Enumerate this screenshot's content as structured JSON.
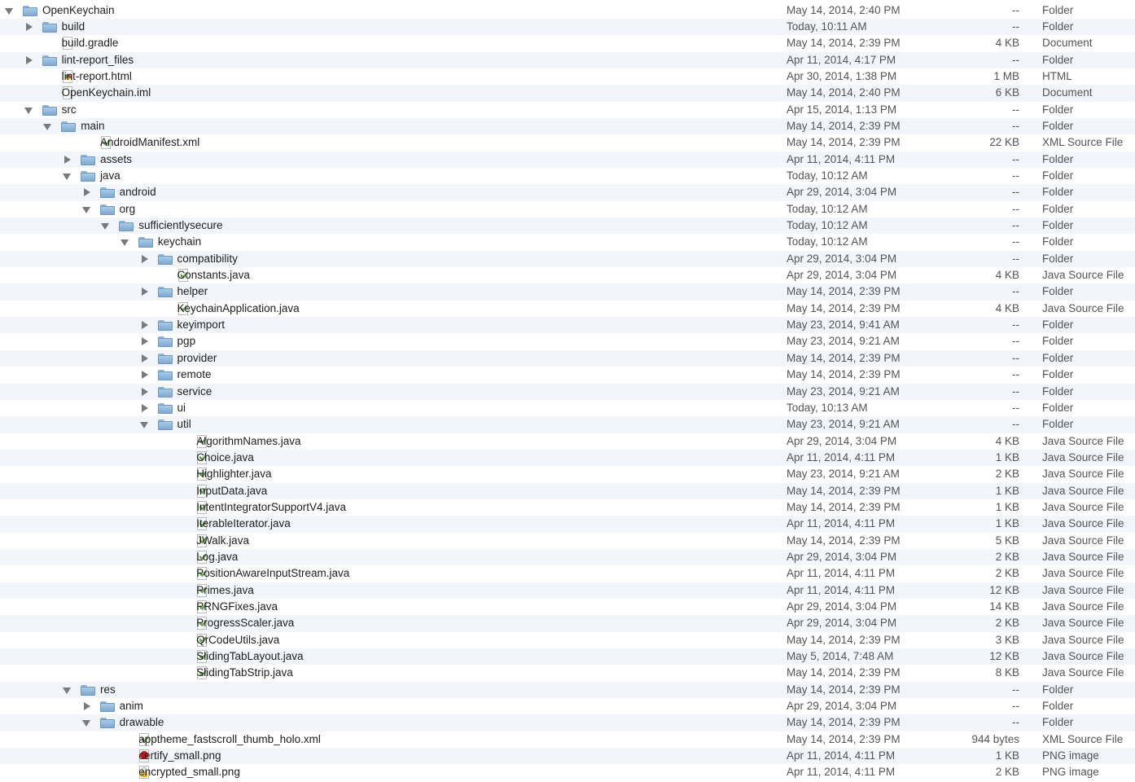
{
  "rows": [
    {
      "name": "OpenKeychain",
      "level": 0,
      "state": "open",
      "icon": "folder",
      "date": "May 14, 2014, 2:40 PM",
      "size": "--",
      "kind": "Folder"
    },
    {
      "name": "build",
      "level": 1,
      "state": "closed",
      "icon": "folder",
      "date": "Today, 10:11 AM",
      "size": "--",
      "kind": "Folder"
    },
    {
      "name": "build.gradle",
      "level": 1,
      "state": "",
      "icon": "document",
      "date": "May 14, 2014, 2:39 PM",
      "size": "4 KB",
      "kind": "Document"
    },
    {
      "name": "lint-report_files",
      "level": 1,
      "state": "closed",
      "icon": "folder",
      "date": "Apr 11, 2014, 4:17 PM",
      "size": "--",
      "kind": "Folder"
    },
    {
      "name": "lint-report.html",
      "level": 1,
      "state": "",
      "icon": "html",
      "date": "Apr 30, 2014, 1:38 PM",
      "size": "1 MB",
      "kind": "HTML"
    },
    {
      "name": "OpenKeychain.iml",
      "level": 1,
      "state": "",
      "icon": "document",
      "date": "May 14, 2014, 2:40 PM",
      "size": "6 KB",
      "kind": "Document"
    },
    {
      "name": "src",
      "level": 1,
      "state": "open",
      "icon": "folder",
      "date": "Apr 15, 2014, 1:13 PM",
      "size": "--",
      "kind": "Folder"
    },
    {
      "name": "main",
      "level": 2,
      "state": "open",
      "icon": "folder",
      "date": "May 14, 2014, 2:39 PM",
      "size": "--",
      "kind": "Folder"
    },
    {
      "name": "AndroidManifest.xml",
      "level": 3,
      "state": "",
      "icon": "xml",
      "date": "May 14, 2014, 2:39 PM",
      "size": "22 KB",
      "kind": "XML Source File"
    },
    {
      "name": "assets",
      "level": 3,
      "state": "closed",
      "icon": "folder",
      "date": "Apr 11, 2014, 4:11 PM",
      "size": "--",
      "kind": "Folder"
    },
    {
      "name": "java",
      "level": 3,
      "state": "open",
      "icon": "folder",
      "date": "Today, 10:12 AM",
      "size": "--",
      "kind": "Folder"
    },
    {
      "name": "android",
      "level": 4,
      "state": "closed",
      "icon": "folder",
      "date": "Apr 29, 2014, 3:04 PM",
      "size": "--",
      "kind": "Folder"
    },
    {
      "name": "org",
      "level": 4,
      "state": "open",
      "icon": "folder",
      "date": "Today, 10:12 AM",
      "size": "--",
      "kind": "Folder"
    },
    {
      "name": "sufficientlysecure",
      "level": 5,
      "state": "open",
      "icon": "folder",
      "date": "Today, 10:12 AM",
      "size": "--",
      "kind": "Folder"
    },
    {
      "name": "keychain",
      "level": 6,
      "state": "open",
      "icon": "folder",
      "date": "Today, 10:12 AM",
      "size": "--",
      "kind": "Folder"
    },
    {
      "name": "compatibility",
      "level": 7,
      "state": "closed",
      "icon": "folder",
      "date": "Apr 29, 2014, 3:04 PM",
      "size": "--",
      "kind": "Folder"
    },
    {
      "name": "Constants.java",
      "level": 7,
      "state": "",
      "icon": "java",
      "date": "Apr 29, 2014, 3:04 PM",
      "size": "4 KB",
      "kind": "Java Source File"
    },
    {
      "name": "helper",
      "level": 7,
      "state": "closed",
      "icon": "folder",
      "date": "May 14, 2014, 2:39 PM",
      "size": "--",
      "kind": "Folder"
    },
    {
      "name": "KeychainApplication.java",
      "level": 7,
      "state": "",
      "icon": "java",
      "date": "May 14, 2014, 2:39 PM",
      "size": "4 KB",
      "kind": "Java Source File"
    },
    {
      "name": "keyimport",
      "level": 7,
      "state": "closed",
      "icon": "folder",
      "date": "May 23, 2014, 9:41 AM",
      "size": "--",
      "kind": "Folder"
    },
    {
      "name": "pgp",
      "level": 7,
      "state": "closed",
      "icon": "folder",
      "date": "May 23, 2014, 9:21 AM",
      "size": "--",
      "kind": "Folder"
    },
    {
      "name": "provider",
      "level": 7,
      "state": "closed",
      "icon": "folder",
      "date": "May 14, 2014, 2:39 PM",
      "size": "--",
      "kind": "Folder"
    },
    {
      "name": "remote",
      "level": 7,
      "state": "closed",
      "icon": "folder",
      "date": "May 14, 2014, 2:39 PM",
      "size": "--",
      "kind": "Folder"
    },
    {
      "name": "service",
      "level": 7,
      "state": "closed",
      "icon": "folder",
      "date": "May 23, 2014, 9:21 AM",
      "size": "--",
      "kind": "Folder"
    },
    {
      "name": "ui",
      "level": 7,
      "state": "closed",
      "icon": "folder",
      "date": "Today, 10:13 AM",
      "size": "--",
      "kind": "Folder"
    },
    {
      "name": "util",
      "level": 7,
      "state": "open",
      "icon": "folder",
      "date": "May 23, 2014, 9:21 AM",
      "size": "--",
      "kind": "Folder"
    },
    {
      "name": "AlgorithmNames.java",
      "level": 8,
      "state": "",
      "icon": "java",
      "date": "Apr 29, 2014, 3:04 PM",
      "size": "4 KB",
      "kind": "Java Source File"
    },
    {
      "name": "Choice.java",
      "level": 8,
      "state": "",
      "icon": "java",
      "date": "Apr 11, 2014, 4:11 PM",
      "size": "1 KB",
      "kind": "Java Source File"
    },
    {
      "name": "Highlighter.java",
      "level": 8,
      "state": "",
      "icon": "java",
      "date": "May 23, 2014, 9:21 AM",
      "size": "2 KB",
      "kind": "Java Source File"
    },
    {
      "name": "InputData.java",
      "level": 8,
      "state": "",
      "icon": "java",
      "date": "May 14, 2014, 2:39 PM",
      "size": "1 KB",
      "kind": "Java Source File"
    },
    {
      "name": "IntentIntegratorSupportV4.java",
      "level": 8,
      "state": "",
      "icon": "java",
      "date": "May 14, 2014, 2:39 PM",
      "size": "1 KB",
      "kind": "Java Source File"
    },
    {
      "name": "IterableIterator.java",
      "level": 8,
      "state": "",
      "icon": "java",
      "date": "Apr 11, 2014, 4:11 PM",
      "size": "1 KB",
      "kind": "Java Source File"
    },
    {
      "name": "JWalk.java",
      "level": 8,
      "state": "",
      "icon": "java",
      "date": "May 14, 2014, 2:39 PM",
      "size": "5 KB",
      "kind": "Java Source File"
    },
    {
      "name": "Log.java",
      "level": 8,
      "state": "",
      "icon": "java",
      "date": "Apr 29, 2014, 3:04 PM",
      "size": "2 KB",
      "kind": "Java Source File"
    },
    {
      "name": "PositionAwareInputStream.java",
      "level": 8,
      "state": "",
      "icon": "java",
      "date": "Apr 11, 2014, 4:11 PM",
      "size": "2 KB",
      "kind": "Java Source File"
    },
    {
      "name": "Primes.java",
      "level": 8,
      "state": "",
      "icon": "java",
      "date": "Apr 11, 2014, 4:11 PM",
      "size": "12 KB",
      "kind": "Java Source File"
    },
    {
      "name": "PRNGFixes.java",
      "level": 8,
      "state": "",
      "icon": "java",
      "date": "Apr 29, 2014, 3:04 PM",
      "size": "14 KB",
      "kind": "Java Source File"
    },
    {
      "name": "ProgressScaler.java",
      "level": 8,
      "state": "",
      "icon": "java",
      "date": "Apr 29, 2014, 3:04 PM",
      "size": "2 KB",
      "kind": "Java Source File"
    },
    {
      "name": "QrCodeUtils.java",
      "level": 8,
      "state": "",
      "icon": "java",
      "date": "May 14, 2014, 2:39 PM",
      "size": "3 KB",
      "kind": "Java Source File"
    },
    {
      "name": "SlidingTabLayout.java",
      "level": 8,
      "state": "",
      "icon": "java",
      "date": "May 5, 2014, 7:48 AM",
      "size": "12 KB",
      "kind": "Java Source File"
    },
    {
      "name": "SlidingTabStrip.java",
      "level": 8,
      "state": "",
      "icon": "java",
      "date": "May 14, 2014, 2:39 PM",
      "size": "8 KB",
      "kind": "Java Source File"
    },
    {
      "name": "res",
      "level": 3,
      "state": "open",
      "icon": "folder",
      "date": "May 14, 2014, 2:39 PM",
      "size": "--",
      "kind": "Folder"
    },
    {
      "name": "anim",
      "level": 4,
      "state": "closed",
      "icon": "folder",
      "date": "Apr 29, 2014, 3:04 PM",
      "size": "--",
      "kind": "Folder"
    },
    {
      "name": "drawable",
      "level": 4,
      "state": "open",
      "icon": "folder",
      "date": "May 14, 2014, 2:39 PM",
      "size": "--",
      "kind": "Folder"
    },
    {
      "name": "apptheme_fastscroll_thumb_holo.xml",
      "level": 5,
      "state": "",
      "icon": "xml",
      "date": "May 14, 2014, 2:39 PM",
      "size": "944 bytes",
      "kind": "XML Source File"
    },
    {
      "name": "certify_small.png",
      "level": 5,
      "state": "",
      "icon": "cert",
      "date": "Apr 11, 2014, 4:11 PM",
      "size": "1 KB",
      "kind": "PNG image"
    },
    {
      "name": "encrypted_small.png",
      "level": 5,
      "state": "",
      "icon": "lock",
      "date": "Apr 11, 2014, 4:11 PM",
      "size": "2 KB",
      "kind": "PNG image"
    }
  ]
}
